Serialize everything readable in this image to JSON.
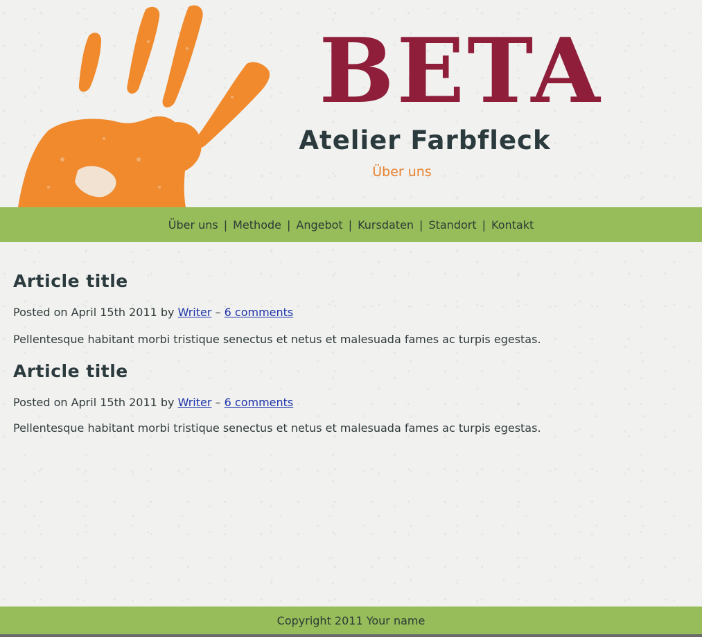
{
  "header": {
    "logo_text": "BETA",
    "site_title": "Atelier Farbfleck",
    "subtitle": "Über uns"
  },
  "nav": {
    "items": [
      "Über uns",
      "Methode",
      "Angebot",
      "Kursdaten",
      "Standort",
      "Kontakt"
    ],
    "separator": "|"
  },
  "posts": [
    {
      "title": "Article title",
      "meta_prefix": "Posted on April 15th 2011 by",
      "author": "Writer",
      "dash": "–",
      "comments": "6 comments",
      "body": "Pellentesque habitant morbi tristique senectus et netus et malesuada fames ac turpis egestas."
    },
    {
      "title": "Article title",
      "meta_prefix": "Posted on April 15th 2011 by",
      "author": "Writer",
      "dash": "–",
      "comments": "6 comments",
      "body": "Pellentesque habitant morbi tristique senectus et netus et malesuada fames ac turpis egestas."
    }
  ],
  "footer": {
    "copyright": "Copyright 2011 Your name"
  },
  "colors": {
    "background": "#f1f1f0",
    "brand_red": "#8e1e3a",
    "accent_orange": "#e8812d",
    "bar_green": "#97bd5a",
    "text_dark": "#2b3a3d",
    "link_blue": "#1a31a8"
  },
  "icons": {
    "logo_image": "orange-handprint"
  }
}
